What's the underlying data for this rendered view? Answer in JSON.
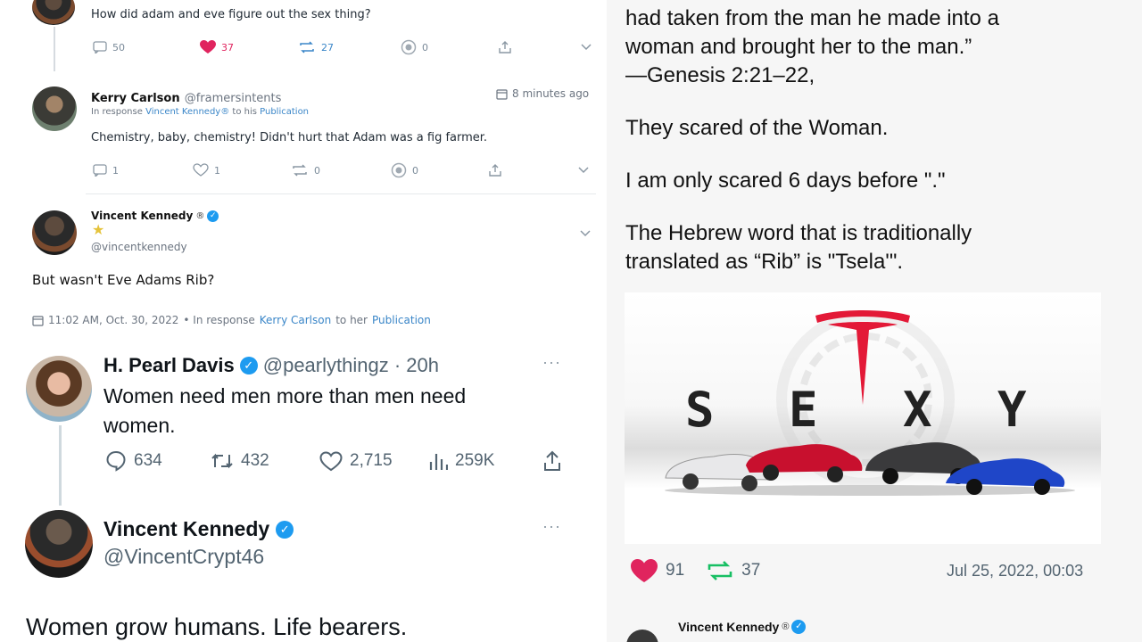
{
  "left_top": {
    "post1": {
      "text": "How did adam and eve figure out the sex thing?",
      "actions": {
        "comments": "50",
        "likes": "37",
        "reposts": "27",
        "views": "0"
      }
    },
    "post2": {
      "name": "Kerry Carlson",
      "handle": "@framersintents",
      "time": "8 minutes ago",
      "response_prefix": "In response",
      "response_user": "Vincent Kennedy",
      "response_mid": "to his",
      "response_pub": "Publication",
      "text": "Chemistry, baby, chemistry! Didn't hurt that Adam was a fig farmer.",
      "actions": {
        "comments": "1",
        "likes": "1",
        "reposts": "0",
        "views": "0"
      }
    },
    "post3": {
      "name": "Vincent Kennedy",
      "star": "★",
      "handle": "@vincentkennedy",
      "text": "But wasn't Eve Adams Rib?",
      "timestamp": "11:02 AM, Oct. 30, 2022",
      "response_prefix": "• In response",
      "response_user": "Kerry Carlson",
      "response_mid": "to her",
      "response_pub": "Publication"
    }
  },
  "left_bottom": {
    "tweet1": {
      "name": "H. Pearl Davis",
      "handle": "@pearlythingz · 20h",
      "text_line1": "Women need men more than men need",
      "text_line2": "women.",
      "actions": {
        "replies": "634",
        "reposts": "432",
        "likes": "2,715",
        "views": "259K"
      }
    },
    "tweet2": {
      "name": "Vincent Kennedy",
      "handle": "@VincentCrypt46",
      "text": "Women grow humans. Life bearers."
    },
    "more": "···"
  },
  "right": {
    "line1": "had taken from the man he made into a",
    "line2": "woman and brought her to the man.”",
    "line3": "—Genesis 2:21–22,",
    "line4": "They scared of the Woman.",
    "line5": "I am only scared 6 days before \".\"",
    "line6": "The Hebrew word that is traditionally",
    "line7": "translated as “Rib” is \"Tsela'\".",
    "image_letters": [
      "S",
      "E",
      "X",
      "Y"
    ],
    "likes": "91",
    "reposts": "37",
    "date": "Jul 25, 2022, 00:03",
    "footer_name": "Vincent Kennedy"
  },
  "colors": {
    "heart": "#e0245e",
    "repost": "#17bf63",
    "blue": "#1d9bf0",
    "tesla_red": "#e31937"
  }
}
